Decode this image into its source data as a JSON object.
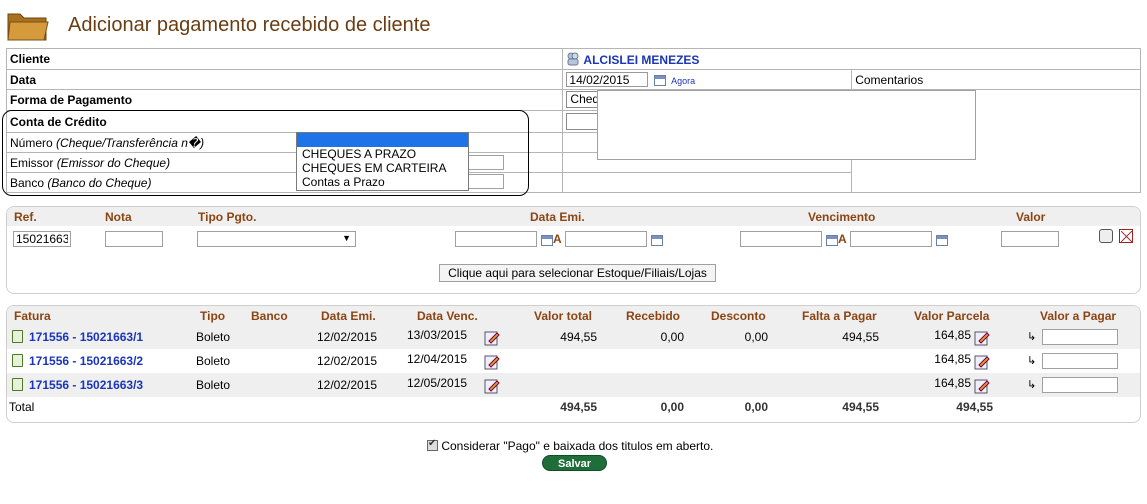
{
  "page": {
    "title": "Adicionar pagamento recebido de cliente"
  },
  "form": {
    "cliente_label": "Cliente",
    "cliente_value": "ALCISLEI MENEZES",
    "data_label": "Data",
    "data_value": "14/02/2015",
    "agora_label": "Agora",
    "comentarios_label": "Comentarios",
    "forma_label": "Forma de Pagamento",
    "forma_value": "Cheque",
    "conta_label": "Conta de Crédito",
    "conta_value": "",
    "numero_label": "Número",
    "numero_hint": "(Cheque/Transferência n�)",
    "emissor_label": "Emissor",
    "emissor_hint": "(Emissor do Cheque)",
    "banco_label": "Banco",
    "banco_hint": "(Banco do Cheque)"
  },
  "conta_dropdown": {
    "options": [
      "",
      "CHEQUES A PRAZO",
      "CHEQUES EM CARTEIRA",
      "Contas a Prazo"
    ]
  },
  "ref_panel": {
    "headers": {
      "ref": "Ref.",
      "nota": "Nota",
      "tipo": "Tipo Pgto.",
      "data_emi": "Data Emi.",
      "vencimento": "Vencimento",
      "valor": "Valor"
    },
    "ref_value": "15021663",
    "a_label": "A",
    "select_button": "Clique aqui para selecionar Estoque/Filiais/Lojas"
  },
  "faturas": {
    "headers": {
      "fatura": "Fatura",
      "tipo": "Tipo",
      "banco": "Banco",
      "data_emi": "Data Emi.",
      "data_venc": "Data Venc.",
      "valor_total": "Valor total",
      "recebido": "Recebido",
      "desconto": "Desconto",
      "falta": "Falta a Pagar",
      "parcela": "Valor Parcela",
      "valor_pagar": "Valor a Pagar"
    },
    "rows": [
      {
        "fatura": "171556 - 15021663/1",
        "tipo": "Boleto",
        "data_emi": "12/02/2015",
        "data_venc": "13/03/2015",
        "valor_total": "494,55",
        "recebido": "0,00",
        "desconto": "0,00",
        "falta": "494,55",
        "parcela": "164,85"
      },
      {
        "fatura": "171556 - 15021663/2",
        "tipo": "Boleto",
        "data_emi": "12/02/2015",
        "data_venc": "12/04/2015",
        "valor_total": "",
        "recebido": "",
        "desconto": "",
        "falta": "",
        "parcela": "164,85"
      },
      {
        "fatura": "171556 - 15021663/3",
        "tipo": "Boleto",
        "data_emi": "12/02/2015",
        "data_venc": "12/05/2015",
        "valor_total": "",
        "recebido": "",
        "desconto": "",
        "falta": "",
        "parcela": "164,85"
      }
    ],
    "total": {
      "label": "Total",
      "valor_total": "494,55",
      "recebido": "0,00",
      "desconto": "0,00",
      "falta": "494,55",
      "parcela": "494,55"
    }
  },
  "footer": {
    "consider_label": "Considerar \"Pago\" e baixada dos titulos em aberto.",
    "consider_checked": true,
    "save_label": "Salvar"
  }
}
